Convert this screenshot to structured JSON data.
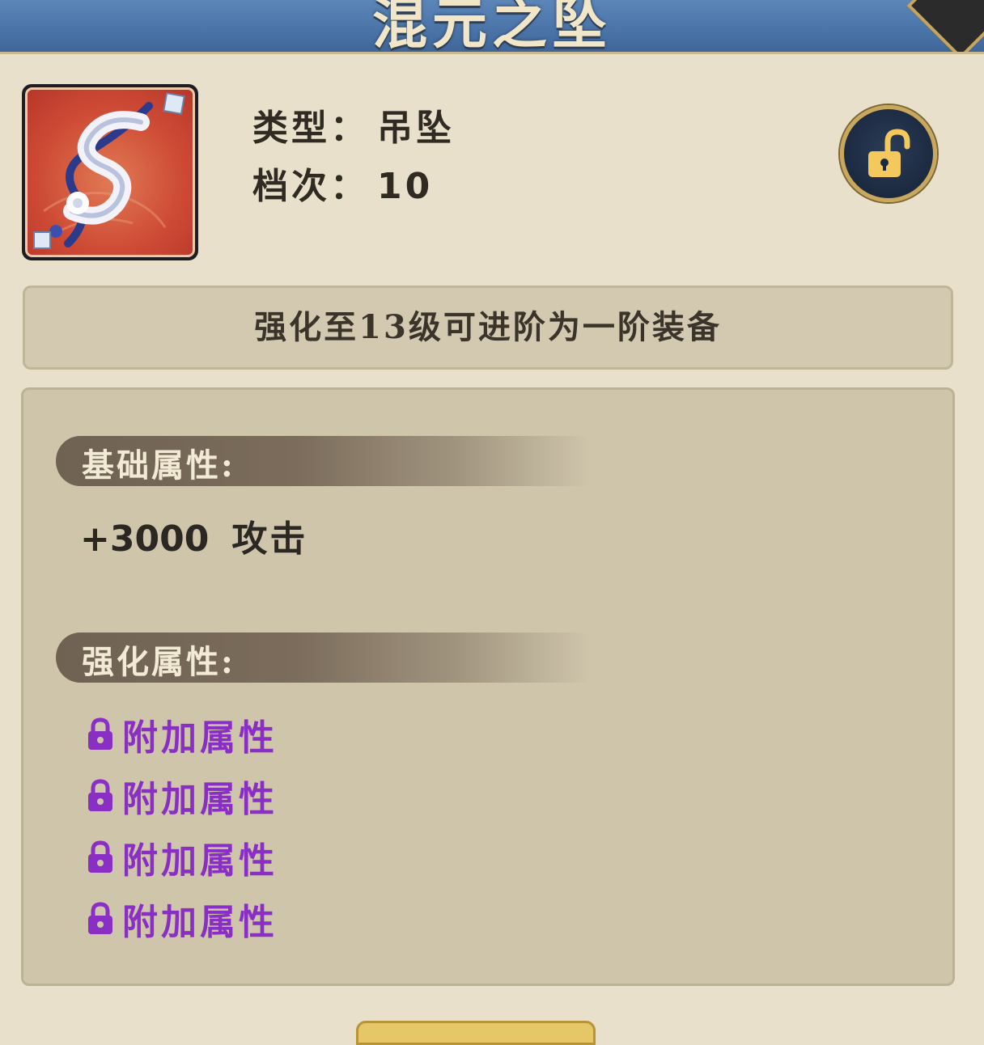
{
  "header": {
    "title": "混元之坠"
  },
  "item": {
    "icon": "pendant-item-icon",
    "type_label": "类型：",
    "type_value": "吊坠",
    "tier_label": "档次：",
    "tier_value": "10",
    "lock_icon": "unlocked-padlock-icon"
  },
  "notice": {
    "text": "强化至13级可进阶为一阶装备"
  },
  "base_attributes": {
    "header": "基础属性:",
    "stats": [
      {
        "value": "+3000",
        "name": "攻击"
      }
    ]
  },
  "enhanced_attributes": {
    "header": "强化属性:",
    "locked_items": [
      {
        "label": "附加属性"
      },
      {
        "label": "附加属性"
      },
      {
        "label": "附加属性"
      },
      {
        "label": "附加属性"
      }
    ],
    "lock_icon": "padlock-icon",
    "color": "#8a2fc4"
  },
  "colors": {
    "header_blue": "#4a74a8",
    "background": "#e8e0cb",
    "panel": "#cfc5ab",
    "gold": "#c9a75c"
  }
}
